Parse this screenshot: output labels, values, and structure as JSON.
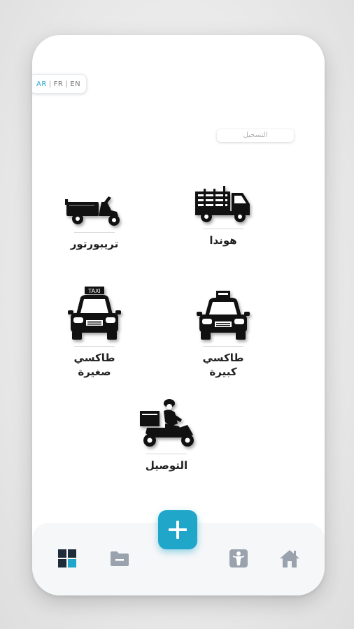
{
  "language_switch": {
    "ar": "AR",
    "fr": "FR",
    "en": "EN",
    "separator": "|"
  },
  "register_label": "التسجيل",
  "services": [
    {
      "id": "tricycle",
      "label": "تريبورتور",
      "icon": "tricycle-icon"
    },
    {
      "id": "honda",
      "label": "هوندا",
      "icon": "truck-icon"
    },
    {
      "id": "small-taxi",
      "label": "طاكسي صغيرة",
      "line1": "طاكسي",
      "line2": "صغيرة",
      "icon": "taxi-icon"
    },
    {
      "id": "big-taxi",
      "label": "طاكسي كبيرة",
      "line1": "طاكسي",
      "line2": "كبيرة",
      "icon": "taxi-icon"
    },
    {
      "id": "delivery",
      "label": "التوصيل",
      "icon": "delivery-scooter-icon"
    }
  ],
  "taxi_sign": "TAXI",
  "bottom_nav": [
    "grid-icon",
    "folder-icon",
    "add-icon",
    "person-icon",
    "home-icon"
  ],
  "colors": {
    "accent": "#1fa6c9",
    "nav_icon": "#9aa3ad"
  }
}
